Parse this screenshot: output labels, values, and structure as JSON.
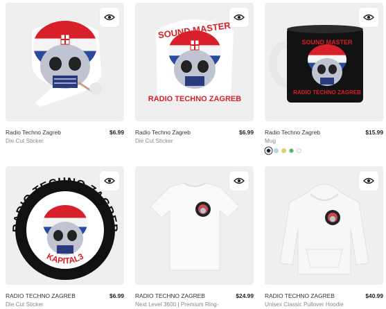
{
  "products": [
    {
      "title": "Radio Techno Zagreb",
      "price": "$6.99",
      "subtitle": "Die Cut Sticker"
    },
    {
      "title": "Radio Techno Zagreb",
      "price": "$6.99",
      "subtitle": "Die Cut Sticker",
      "art_top": "SOUND MASTER",
      "art_bottom": "RADIO TECHNO ZAGREB"
    },
    {
      "title": "Radio Techno Zagreb",
      "price": "$15.99",
      "subtitle": "Mug",
      "art_top": "SOUND MASTER",
      "art_bottom": "RADIO TECHNO ZAGREB",
      "swatches": [
        "#0a1a3a",
        "#a8dde6",
        "#f2d21a",
        "#3cc23c",
        "#ffffff"
      ]
    },
    {
      "title": "RADIO TECHNO ZAGREB",
      "price": "$6.99",
      "subtitle": "Die Cut Sticker",
      "art_top": "RADIO TECHNO ZAGREB",
      "art_bottom": "KAPITAL3"
    },
    {
      "title": "RADIO TECHNO ZAGREB",
      "price": "$24.99",
      "subtitle": "Next Level 3600 | Premium Ring-"
    },
    {
      "title": "RADIO TECHNO ZAGREB",
      "price": "$40.99",
      "subtitle": "Unisex Classic Pullover Hoodie"
    }
  ],
  "colors": {
    "card_bg": "#efefef",
    "accent_red": "#d8202a",
    "flag_blue": "#1f3a93"
  }
}
